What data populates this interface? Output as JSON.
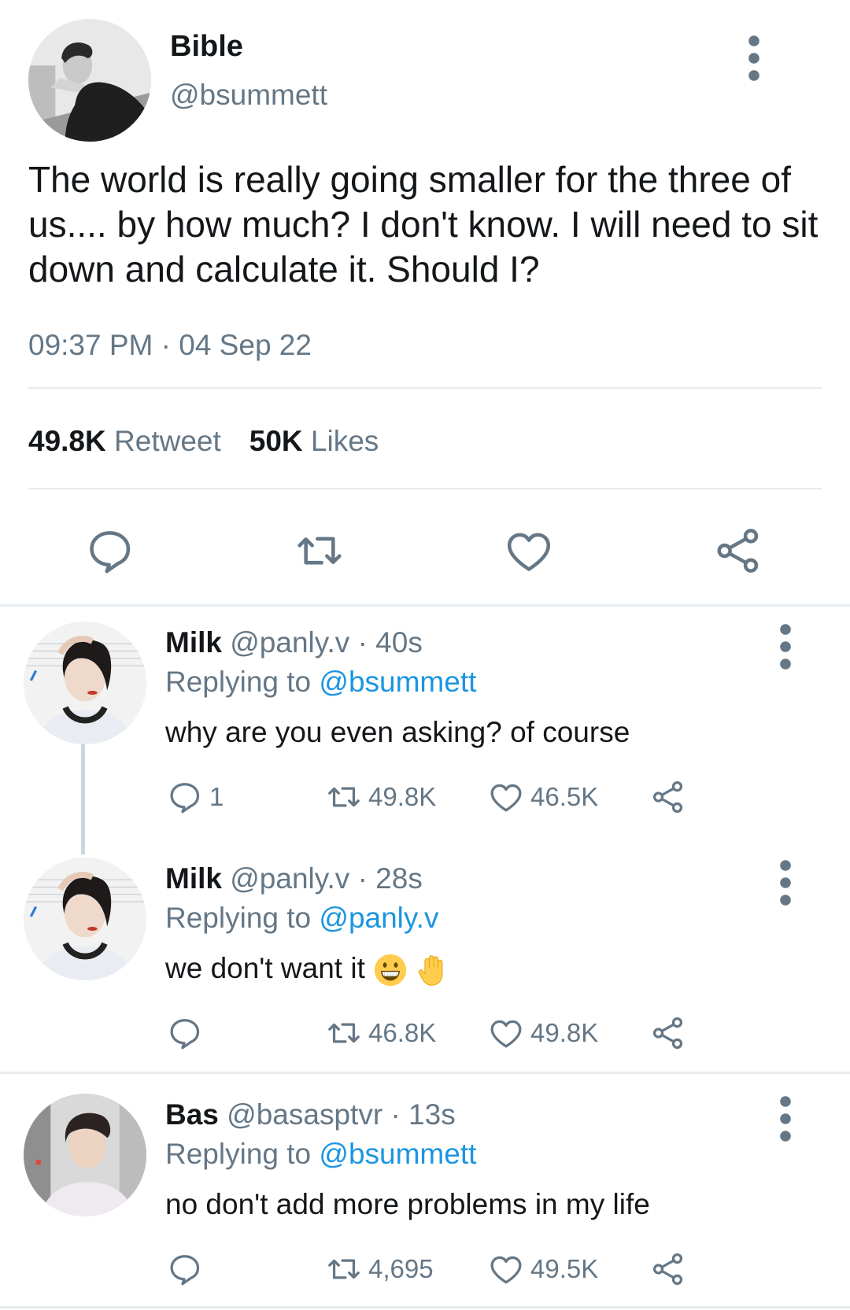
{
  "tweet": {
    "name": "Bible",
    "handle": "@bsummett",
    "text": "The world is really going smaller for the three of us.... by how much? I don't know. I will need to sit down and calculate it. Should I?",
    "time": "09:37 PM · 04 Sep 22",
    "retweets": "49.8K",
    "retweets_label": "Retweet",
    "likes": "50K",
    "likes_label": "Likes"
  },
  "replies": [
    {
      "name": "Milk",
      "handle": "@panly.v",
      "time": "· 40s",
      "replying_label": "Replying to",
      "replying_to": "@bsummett",
      "text": "why are you even asking? of course",
      "replies_count": "1",
      "retweets": "49.8K",
      "likes": "46.5K"
    },
    {
      "name": "Milk",
      "handle": "@panly.v",
      "time": "· 28s",
      "replying_label": "Replying to",
      "replying_to": "@panly.v",
      "text": "we don't want it",
      "emojis": [
        "grinning-face-emoji",
        "raised-hand-emoji"
      ],
      "replies_count": "",
      "retweets": "46.8K",
      "likes": "49.8K"
    },
    {
      "name": "Bas",
      "handle": "@basasptvr",
      "time": "· 13s",
      "replying_label": "Replying to",
      "replying_to": "@bsummett",
      "text": "no don't add more problems in my life",
      "replies_count": "",
      "retweets": "4,695",
      "likes": "49.5K"
    }
  ],
  "icons": [
    "reply-icon",
    "retweet-icon",
    "like-icon",
    "share-icon",
    "more-options-icon"
  ],
  "colors": {
    "text": "#14171a",
    "muted": "#657786",
    "link": "#1b95e0",
    "divider": "#e6ecf0"
  }
}
